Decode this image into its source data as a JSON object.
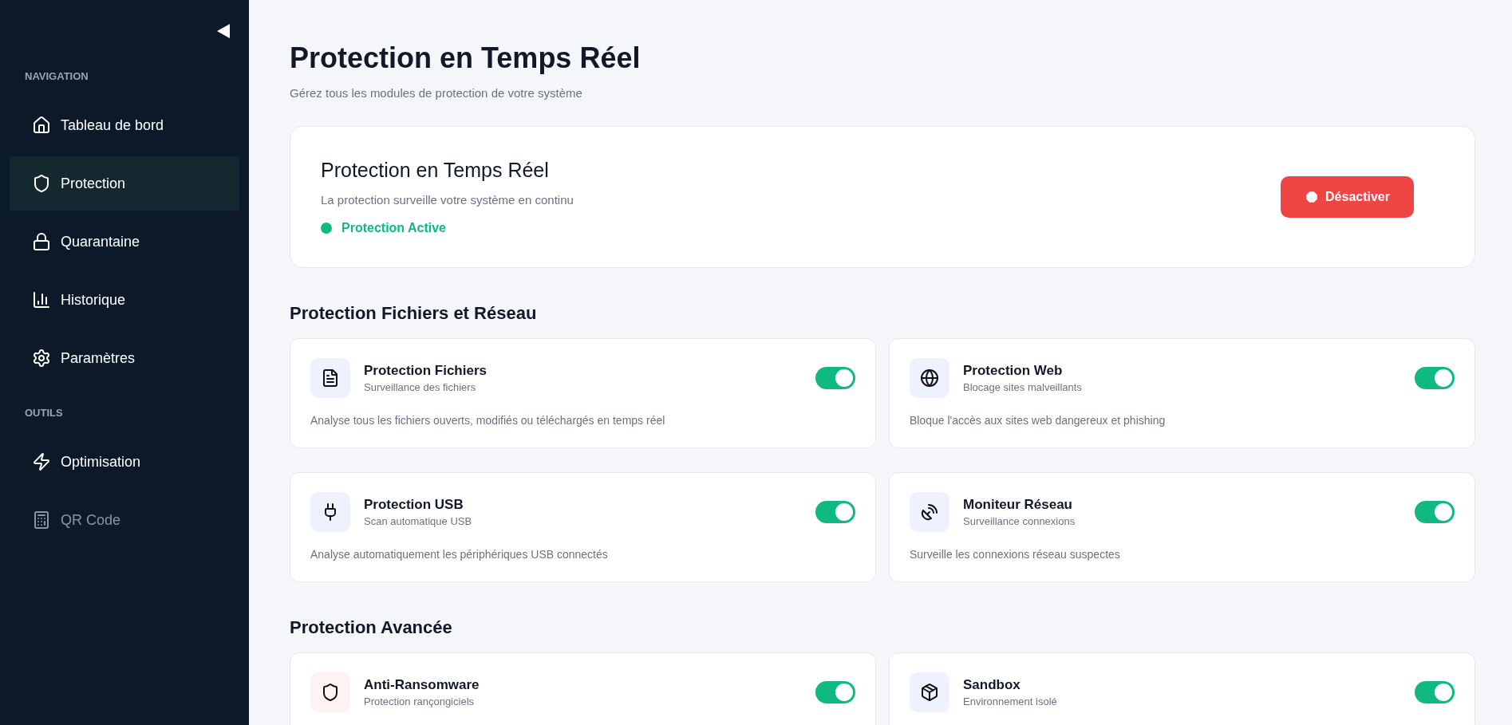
{
  "sidebar": {
    "sections": [
      {
        "title": "NAVIGATION",
        "items": [
          {
            "label": "Tableau de bord",
            "selected": false,
            "disabled": false
          },
          {
            "label": "Protection",
            "selected": true,
            "disabled": false
          },
          {
            "label": "Quarantaine",
            "selected": false,
            "disabled": false
          },
          {
            "label": "Historique",
            "selected": false,
            "disabled": false
          },
          {
            "label": "Paramètres",
            "selected": false,
            "disabled": false
          }
        ]
      },
      {
        "title": "OUTILS",
        "items": [
          {
            "label": "Optimisation",
            "selected": false,
            "disabled": false
          },
          {
            "label": "QR Code",
            "selected": false,
            "disabled": true
          }
        ]
      }
    ]
  },
  "page": {
    "title": "Protection en Temps Réel",
    "subtitle": "Gérez tous les modules de protection de votre système"
  },
  "status_card": {
    "title": "Protection en Temps Réel",
    "description": "La protection surveille votre système en continu",
    "status": "Protection Active",
    "active": true,
    "button": "Désactiver"
  },
  "sections": [
    {
      "title": "Protection Fichiers et Réseau",
      "modules": [
        {
          "name": "Protection Fichiers",
          "subtitle": "Surveillance des fichiers",
          "description": "Analyse tous les fichiers ouverts, modifiés ou téléchargés en temps réel",
          "color": "#eef2ff",
          "on": true
        },
        {
          "name": "Protection Web",
          "subtitle": "Blocage sites malveillants",
          "description": "Bloque l'accès aux sites web dangereux et phishing",
          "color": "#eef2ff",
          "on": true
        },
        {
          "name": "Protection USB",
          "subtitle": "Scan automatique USB",
          "description": "Analyse automatiquement les périphériques USB connectés",
          "color": "#eef2ff",
          "on": true
        },
        {
          "name": "Moniteur Réseau",
          "subtitle": "Surveillance connexions",
          "description": "Surveille les connexions réseau suspectes",
          "color": "#eef2ff",
          "on": true
        }
      ]
    },
    {
      "title": "Protection Avancée",
      "modules": [
        {
          "name": "Anti-Ransomware",
          "subtitle": "Protection rançongiciels",
          "color": "#fef2f2",
          "on": true
        },
        {
          "name": "Sandbox",
          "subtitle": "Environnement isolé",
          "color": "#eef2ff",
          "on": true
        }
      ]
    }
  ]
}
